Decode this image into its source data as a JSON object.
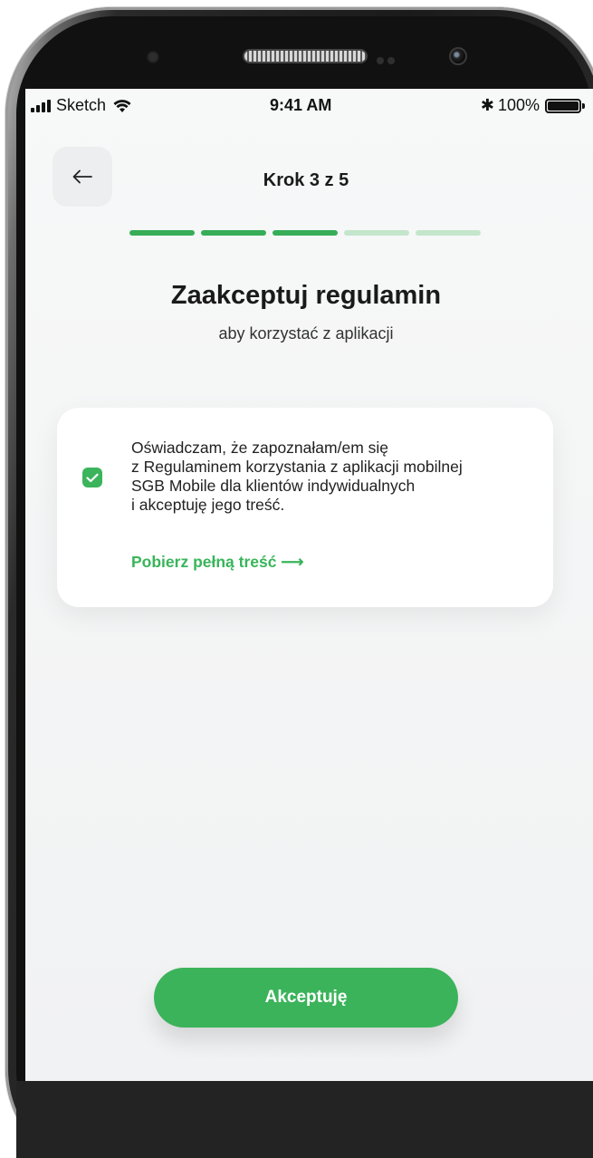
{
  "statusbar": {
    "carrier": "Sketch",
    "time": "9:41 AM",
    "battery": "100%",
    "icons": [
      "signal-icon",
      "wifi-icon",
      "bluetooth-icon",
      "battery-icon"
    ]
  },
  "header": {
    "back_icon": "arrow-left-icon",
    "step_label": "Krok 3 z 5"
  },
  "progress": {
    "current_step": 3,
    "total_steps": 5,
    "active_color": "#37ad58",
    "inactive_color": "#c4e6cc"
  },
  "page": {
    "title": "Zaakceptuj regulamin",
    "subtitle": "aby korzystać z aplikacji"
  },
  "consent": {
    "checked": true,
    "lines": [
      "Oświadczam, że zapoznałam/em się",
      "z Regulaminem korzystania z aplikacji mobilnej",
      "SGB Mobile dla klientów indywidualnych",
      "i akceptuję jego treść."
    ],
    "link_label": "Pobierz pełną treść ⟶"
  },
  "footer": {
    "accept_label": "Akceptuję"
  },
  "colors": {
    "accent": "#3bb35a",
    "background": "#f4f5f6",
    "card": "#ffffff"
  }
}
